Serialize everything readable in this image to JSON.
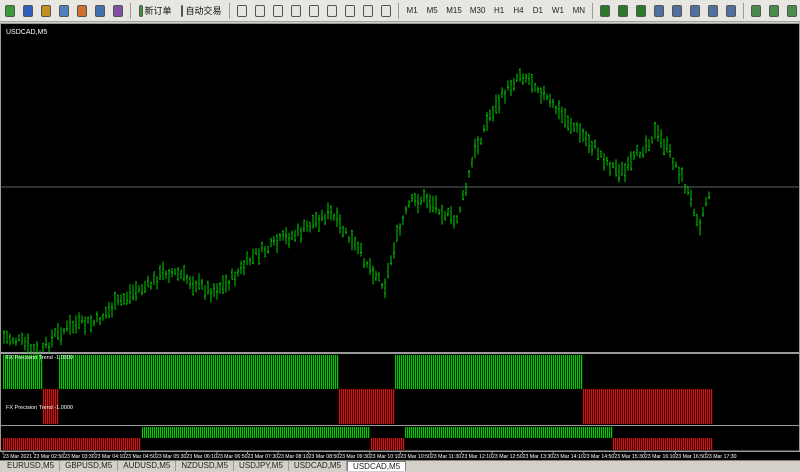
{
  "toolbar": {
    "new_order_label": "新订单",
    "auto_trading_label": "自动交易",
    "timeframes": [
      "M1",
      "M5",
      "M15",
      "M30",
      "H1",
      "H4",
      "D1",
      "W1",
      "MN"
    ],
    "icons": [
      "new-chart-icon",
      "profiles-icon",
      "market-watch-icon",
      "data-window-icon",
      "navigator-icon",
      "terminal-icon",
      "tester-icon",
      "new-order-icon",
      "auto-trading-icon",
      "cursor-icon",
      "crosshair-icon",
      "vertical-line-icon",
      "horizontal-line-icon",
      "trendline-icon",
      "channel-icon",
      "fibonacci-icon",
      "text-icon",
      "arrow-icon",
      "bar-chart-icon",
      "candles-icon",
      "line-chart-icon",
      "zoom-in-icon",
      "zoom-out-icon",
      "tile-icon",
      "autoscroll-icon",
      "chart-shift-icon",
      "indicators-icon",
      "periods-icon",
      "templates-icon"
    ]
  },
  "chart": {
    "symbol_label": "USDCAD,M5",
    "price_line_color": "#808080",
    "bar_color": "#00cc00",
    "background": "#000000"
  },
  "indicators": [
    {
      "label": "FX Precision Trend -1.0000",
      "up_color": "#00cc00",
      "down_color": "#e01010"
    },
    {
      "label": "FX Precision Trend -1.0000",
      "up_color": "#00cc00",
      "down_color": "#e01010"
    }
  ],
  "time_axis": [
    "23 Mar 2021",
    "23 Mar 02:50",
    "23 Mar 03:30",
    "23 Mar 04:10",
    "23 Mar 04:50",
    "23 Mar 05:30",
    "23 Mar 06:10",
    "23 Mar 06:50",
    "23 Mar 07:30",
    "23 Mar 08:10",
    "23 Mar 08:50",
    "23 Mar 09:30",
    "23 Mar 10:10",
    "23 Mar 10:50",
    "23 Mar 11:30",
    "23 Mar 12:10",
    "23 Mar 12:50",
    "23 Mar 13:30",
    "23 Mar 14:10",
    "23 Mar 14:50",
    "23 Mar 15:30",
    "23 Mar 16:10",
    "23 Mar 16:50",
    "23 Mar 17:30"
  ],
  "tabs": [
    {
      "label": "EURUSD,M5",
      "active": false
    },
    {
      "label": "GBPUSD,M5",
      "active": false
    },
    {
      "label": "AUDUSD,M5",
      "active": false
    },
    {
      "label": "NZDUSD,M5",
      "active": false
    },
    {
      "label": "USDJPY,M5",
      "active": false
    },
    {
      "label": "USDCAD,M5",
      "active": false
    },
    {
      "label": "USDCAD,M5",
      "active": true
    }
  ]
}
